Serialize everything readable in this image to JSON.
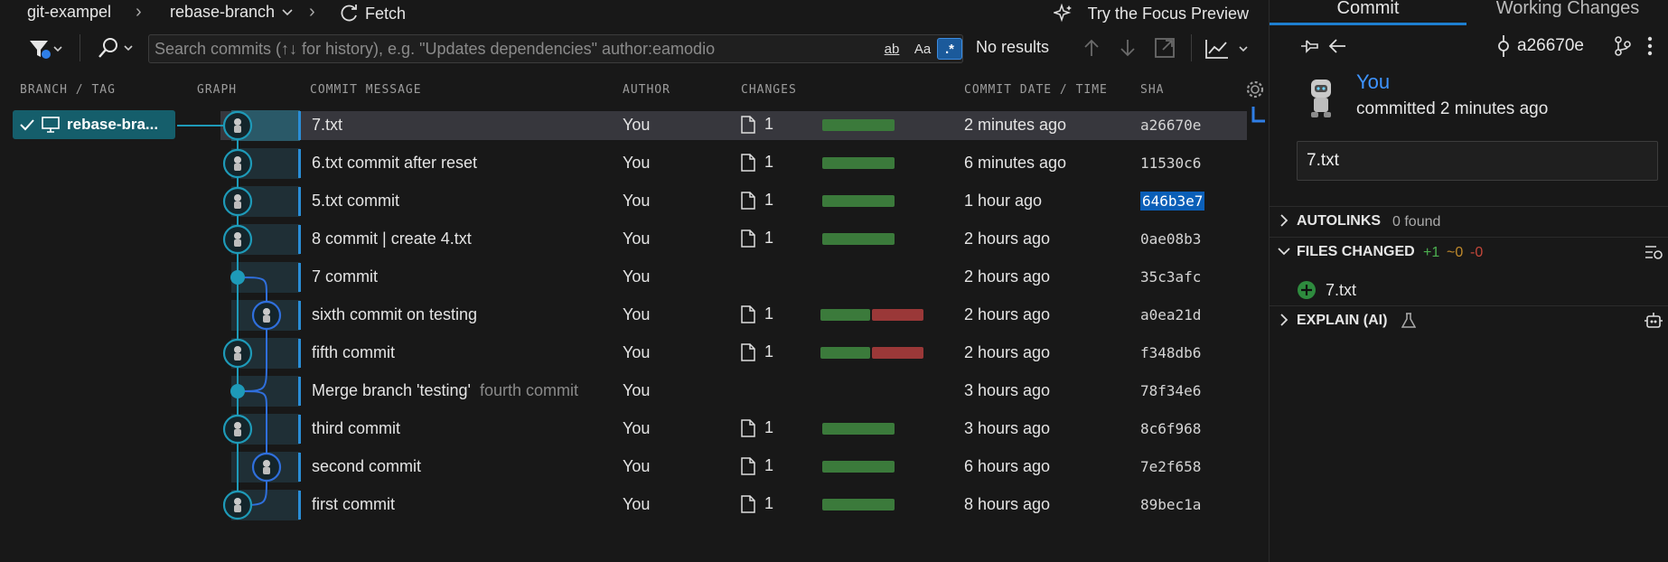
{
  "topbar": {
    "repo": "git-exampel",
    "branch": "rebase-branch",
    "fetch_label": "Fetch",
    "focus_label": "Try the Focus Preview"
  },
  "search": {
    "placeholder": "Search commits (↑↓ for history), e.g. \"Updates dependencies\" author:eamodio",
    "value": "",
    "opt_word": "ab",
    "opt_case": "Aa",
    "opt_regex": ".*",
    "result_text": "No results"
  },
  "columns": {
    "branch_tag": "BRANCH / TAG",
    "graph": "GRAPH",
    "commit_message": "COMMIT MESSAGE",
    "author": "AUTHOR",
    "changes": "CHANGES",
    "commit_date": "COMMIT DATE / TIME",
    "sha": "SHA"
  },
  "branch_tag": {
    "label": "rebase-bra..."
  },
  "commits": [
    {
      "message": "7.txt",
      "sub": "",
      "author": "You",
      "files": "1",
      "date": "2 minutes ago",
      "sha": "a26670e",
      "added": 1.0,
      "deleted": 0.0
    },
    {
      "message": "6.txt commit after reset",
      "sub": "",
      "author": "You",
      "files": "1",
      "date": "6 minutes ago",
      "sha": "11530c6",
      "added": 1.0,
      "deleted": 0.0
    },
    {
      "message": "5.txt commit",
      "sub": "",
      "author": "You",
      "files": "1",
      "date": "1 hour ago",
      "sha": "646b3e7",
      "added": 1.0,
      "deleted": 0.0
    },
    {
      "message": "8 commit | create 4.txt",
      "sub": "",
      "author": "You",
      "files": "1",
      "date": "2 hours ago",
      "sha": "0ae08b3",
      "added": 1.0,
      "deleted": 0.0
    },
    {
      "message": "7 commit",
      "sub": "",
      "author": "You",
      "files": "",
      "date": "2 hours ago",
      "sha": "35c3afc",
      "added": 0,
      "deleted": 0
    },
    {
      "message": "sixth commit on testing",
      "sub": "",
      "author": "You",
      "files": "1",
      "date": "2 hours ago",
      "sha": "a0ea21d",
      "added": 0.5,
      "deleted": 0.5
    },
    {
      "message": "fifth commit",
      "sub": "",
      "author": "You",
      "files": "1",
      "date": "2 hours ago",
      "sha": "f348db6",
      "added": 0.5,
      "deleted": 0.5
    },
    {
      "message": "Merge branch 'testing'",
      "sub": "fourth commit",
      "author": "You",
      "files": "",
      "date": "3 hours ago",
      "sha": "78f34e6",
      "added": 0,
      "deleted": 0
    },
    {
      "message": "third commit",
      "sub": "",
      "author": "You",
      "files": "1",
      "date": "3 hours ago",
      "sha": "8c6f968",
      "added": 1.0,
      "deleted": 0.0
    },
    {
      "message": "second commit",
      "sub": "",
      "author": "You",
      "files": "1",
      "date": "6 hours ago",
      "sha": "7e2f658",
      "added": 1.0,
      "deleted": 0.0
    },
    {
      "message": "first commit",
      "sub": "",
      "author": "You",
      "files": "1",
      "date": "8 hours ago",
      "sha": "89bec1a",
      "added": 1.0,
      "deleted": 0.0
    }
  ],
  "details": {
    "tab_commit": "Commit",
    "tab_working": "Working Changes",
    "sha": "a26670e",
    "author": "You",
    "committed": "committed 2 minutes ago",
    "message": "7.txt",
    "autolinks_title": "AUTOLINKS",
    "autolinks_count": "0 found",
    "files_title": "FILES CHANGED",
    "files_added": "+1",
    "files_modified": "~0",
    "files_deleted": "-0",
    "file_name": "7.txt",
    "explain_title": "EXPLAIN (AI)"
  },
  "colors": {
    "accent": "#1e7fd0",
    "graph_main": "#1e9ab8",
    "graph_branch": "#2f6fdc",
    "added": "#3b7a3b",
    "deleted": "#9a3838",
    "branch_tag_bg": "#155e6b"
  },
  "icons": [
    "filter-icon",
    "search-icon",
    "refresh-icon",
    "sparkle-icon",
    "arrow-up-icon",
    "arrow-down-icon",
    "open-external-icon",
    "chart-icon",
    "gear-icon",
    "computer-icon",
    "check-icon",
    "file-icon",
    "pin-icon",
    "arrow-left-icon",
    "commit-icon",
    "branch-graph-icon",
    "more-icon",
    "chevron-right-icon",
    "chevron-down-icon",
    "add-circle-icon",
    "flask-icon",
    "list-view-icon",
    "robot-icon"
  ]
}
